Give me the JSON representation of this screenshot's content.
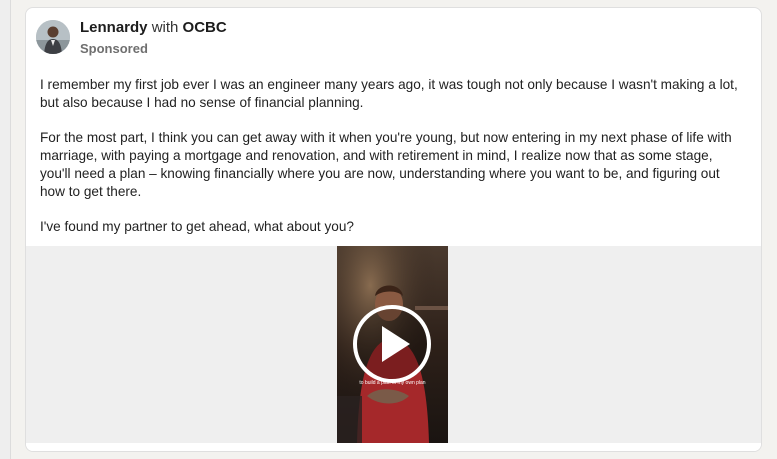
{
  "post": {
    "author": "Lennardy",
    "with_text": "with",
    "company": "OCBC",
    "sponsored_label": "Sponsored",
    "paragraphs": [
      "I remember my first job ever I was an engineer many years ago, it was tough not only because I wasn't making a lot, but also because I had no sense of financial planning.",
      "For the most part, I think you can get away with it when you're young, but now entering in my next phase of life with marriage, with paying a mortgage and renovation, and with retirement in mind, I realize now that as some stage, you'll need a plan – knowing financially where you are now, understanding where you want to be, and figuring out how to get there.",
      "I've found my partner to get ahead, what about you?"
    ]
  },
  "video": {
    "caption": "to build a plan of my own plan"
  },
  "icons": {
    "play": "play-circle-icon",
    "avatar": "person-avatar"
  },
  "colors": {
    "card_background": "#ffffff",
    "page_background": "#f3f2ef",
    "media_background": "#efefef",
    "sponsored_text": "#6f6f6f"
  }
}
